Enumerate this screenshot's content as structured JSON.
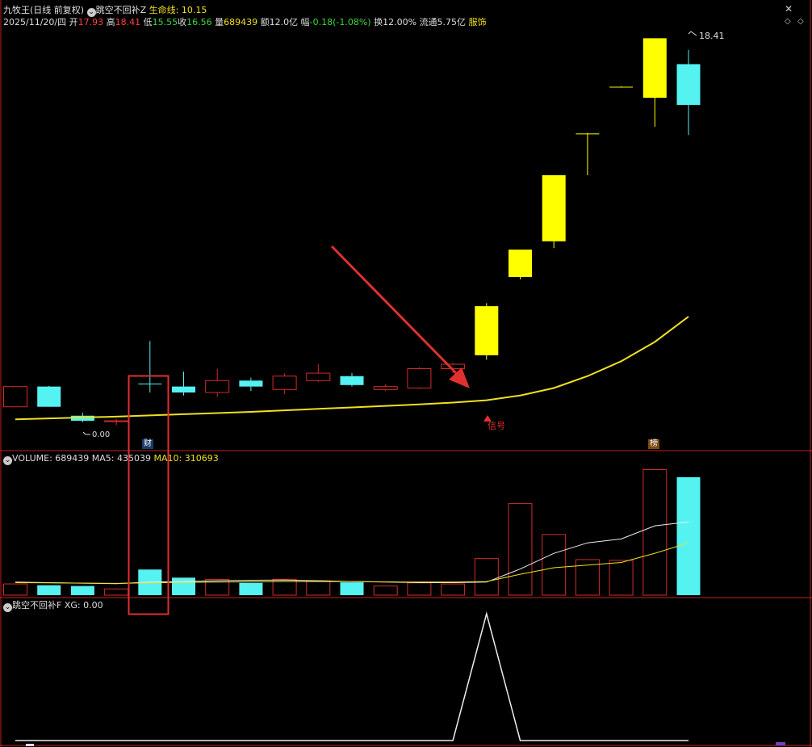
{
  "window": {
    "stock_name": "九牧王",
    "period_label": "(日线 前复权)",
    "indicator_main": "跳空不回补Z",
    "lifeline_label": "生命线:",
    "lifeline_value": "10.15"
  },
  "quote": {
    "date": "2025/11/20/四",
    "open_label": "开",
    "open": "17.93",
    "high_label": "高",
    "high": "18.41",
    "low_label": "低",
    "low": "15.55",
    "close_label": "收",
    "close": "16.56",
    "vol_label": "量",
    "volume": "689439",
    "amount_label": "额",
    "amount": "12.0亿",
    "change_label": "幅",
    "change": "-0.18(-1.08%)",
    "turnover_label": "换",
    "turnover": "12.00%",
    "float_label": "流通",
    "float_cap": "5.75亿",
    "sector": "服饰"
  },
  "price_labels": {
    "high_mark": "18.41",
    "low_mark": "0.00"
  },
  "markers": {
    "cai": "财",
    "signal": "信号",
    "bang": "榜"
  },
  "volume_panel": {
    "title": "VOLUME:",
    "volume": "689439",
    "ma5_label": "MA5:",
    "ma5": "435039",
    "ma10_label": "MA10:",
    "ma10": "310693"
  },
  "indicator_panel": {
    "title": "跳空不回补F",
    "xg_label": "XG:",
    "xg": "0.00"
  },
  "colors": {
    "up": "#d42b2b",
    "down": "#55f2f2",
    "signal": "#ffff00",
    "lifeline": "#f0e020",
    "frame": "#b22222",
    "annotation": "#e03030"
  },
  "chart_data": [
    {
      "type": "candlestick",
      "title": "九牧王 (日线 前复权)",
      "candles": [
        {
          "o": 7.1,
          "h": 7.12,
          "l": 6.42,
          "c": 6.42,
          "color": "up-hollow"
        },
        {
          "o": 7.1,
          "h": 7.12,
          "l": 6.42,
          "c": 6.42,
          "color": "cyan"
        },
        {
          "o": 6.12,
          "h": 6.22,
          "l": 5.9,
          "c": 5.95,
          "color": "cyan"
        },
        {
          "o": 5.92,
          "h": 6.02,
          "l": 5.8,
          "c": 5.95,
          "color": "up-hollow"
        },
        {
          "o": 7.2,
          "h": 8.63,
          "l": 6.9,
          "c": 7.2,
          "color": "cyan"
        },
        {
          "o": 7.1,
          "h": 7.6,
          "l": 6.8,
          "c": 6.9,
          "color": "cyan"
        },
        {
          "o": 6.9,
          "h": 7.7,
          "l": 6.75,
          "c": 7.3,
          "color": "up-hollow"
        },
        {
          "o": 7.3,
          "h": 7.4,
          "l": 6.95,
          "c": 7.1,
          "color": "cyan"
        },
        {
          "o": 7.0,
          "h": 7.55,
          "l": 6.85,
          "c": 7.45,
          "color": "up-hollow"
        },
        {
          "o": 7.3,
          "h": 7.85,
          "l": 7.25,
          "c": 7.55,
          "color": "up-hollow"
        },
        {
          "o": 7.45,
          "h": 7.55,
          "l": 7.1,
          "c": 7.15,
          "color": "cyan"
        },
        {
          "o": 7.0,
          "h": 7.18,
          "l": 6.95,
          "c": 7.1,
          "color": "up-hollow"
        },
        {
          "o": 7.05,
          "h": 7.75,
          "l": 7.02,
          "c": 7.7,
          "color": "up-hollow"
        },
        {
          "o": 7.7,
          "h": 7.9,
          "l": 7.55,
          "c": 7.85,
          "color": "up-hollow"
        },
        {
          "o": 8.15,
          "h": 9.9,
          "l": 8.0,
          "c": 9.8,
          "color": "signal"
        },
        {
          "o": 10.78,
          "h": 11.7,
          "l": 10.7,
          "c": 11.7,
          "color": "signal"
        },
        {
          "o": 11.98,
          "h": 14.2,
          "l": 11.75,
          "c": 14.2,
          "color": "signal"
        },
        {
          "o": 15.6,
          "h": 15.62,
          "l": 14.2,
          "c": 15.6,
          "color": "signal"
        },
        {
          "o": 17.17,
          "h": 17.19,
          "l": 17.15,
          "c": 17.17,
          "color": "signal"
        },
        {
          "o": 16.8,
          "h": 18.8,
          "l": 15.83,
          "c": 18.8,
          "color": "signal"
        },
        {
          "o": 17.93,
          "h": 18.41,
          "l": 15.55,
          "c": 16.56,
          "color": "cyan"
        }
      ],
      "lifeline": [
        6.0,
        6.03,
        6.06,
        6.09,
        6.13,
        6.17,
        6.21,
        6.25,
        6.3,
        6.35,
        6.4,
        6.45,
        6.5,
        6.56,
        6.64,
        6.8,
        7.05,
        7.45,
        7.95,
        8.6,
        9.45
      ],
      "ylim": [
        5.3,
        19.0
      ]
    },
    {
      "type": "bar",
      "title": "VOLUME",
      "values": [
        43000,
        38000,
        35000,
        24000,
        98000,
        67000,
        60000,
        47000,
        61000,
        55000,
        49000,
        35000,
        47000,
        43000,
        140000,
        350000,
        232000,
        136000,
        133000,
        480000,
        451000
      ],
      "colors": [
        "up-hollow",
        "cyan",
        "cyan",
        "up-hollow",
        "cyan",
        "cyan",
        "up-hollow",
        "cyan",
        "up-hollow",
        "up-hollow",
        "cyan",
        "up-hollow",
        "up-hollow",
        "up-hollow",
        "up-hollow",
        "up-hollow",
        "up-hollow",
        "up-hollow",
        "up-hollow",
        "up-hollow",
        "cyan"
      ],
      "ma5": [
        50000,
        48000,
        46000,
        44000,
        50000,
        52000,
        55000,
        57000,
        58000,
        55000,
        52000,
        50000,
        48000,
        48000,
        50000,
        100000,
        160000,
        200000,
        215000,
        265000,
        280000
      ],
      "ma10": [
        48000,
        47000,
        46000,
        45000,
        47000,
        49000,
        50000,
        51000,
        52000,
        52000,
        52000,
        51000,
        50000,
        50000,
        52000,
        80000,
        105000,
        115000,
        125000,
        160000,
        200000
      ],
      "ylim": [
        0,
        500000
      ]
    },
    {
      "type": "line",
      "title": "跳空不回补F XG",
      "values": [
        0,
        0,
        0,
        0,
        0,
        0,
        0,
        0,
        0,
        0,
        0,
        0,
        0,
        0,
        1,
        0,
        0,
        0,
        0,
        0,
        0
      ],
      "ylim": [
        0,
        1
      ]
    }
  ]
}
